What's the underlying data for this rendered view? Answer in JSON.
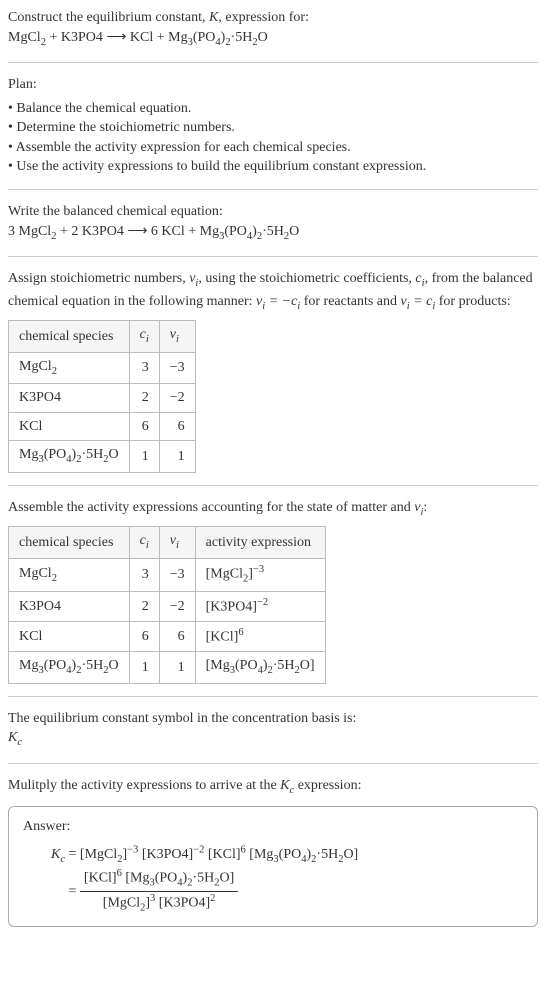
{
  "intro": {
    "line1": "Construct the equilibrium constant, ",
    "K": "K",
    "line1b": ", expression for:",
    "equation_lhs": "MgCl₂ + K3PO4",
    "arrow": " ⟶ ",
    "equation_rhs": "KCl + Mg₃(PO₄)₂·5H₂O"
  },
  "plan": {
    "heading": "Plan:",
    "items": [
      "Balance the chemical equation.",
      "Determine the stoichiometric numbers.",
      "Assemble the activity expression for each chemical species.",
      "Use the activity expressions to build the equilibrium constant expression."
    ]
  },
  "balanced": {
    "heading": "Write the balanced chemical equation:",
    "lhs": "3 MgCl₂ + 2 K3PO4",
    "arrow": " ⟶ ",
    "rhs": "6 KCl + Mg₃(PO₄)₂·5H₂O"
  },
  "stoich": {
    "text1": "Assign stoichiometric numbers, ",
    "nu_i": "νᵢ",
    "text2": ", using the stoichiometric coefficients, ",
    "c_i": "cᵢ",
    "text3": ", from the balanced chemical equation in the following manner: ",
    "rel1": "νᵢ = −cᵢ",
    "text4": " for reactants and ",
    "rel2": "νᵢ = cᵢ",
    "text5": " for products:",
    "headers": {
      "species": "chemical species",
      "c": "cᵢ",
      "nu": "νᵢ"
    },
    "rows": [
      {
        "species": "MgCl₂",
        "c": "3",
        "nu": "−3"
      },
      {
        "species": "K3PO4",
        "c": "2",
        "nu": "−2"
      },
      {
        "species": "KCl",
        "c": "6",
        "nu": "6"
      },
      {
        "species": "Mg₃(PO₄)₂·5H₂O",
        "c": "1",
        "nu": "1"
      }
    ]
  },
  "activity": {
    "text1": "Assemble the activity expressions accounting for the state of matter and ",
    "nu_i": "νᵢ",
    "text2": ":",
    "headers": {
      "species": "chemical species",
      "c": "cᵢ",
      "nu": "νᵢ",
      "expr": "activity expression"
    },
    "rows": [
      {
        "species": "MgCl₂",
        "c": "3",
        "nu": "−3",
        "expr": "[MgCl₂]⁻³"
      },
      {
        "species": "K3PO4",
        "c": "2",
        "nu": "−2",
        "expr": "[K3PO4]⁻²"
      },
      {
        "species": "KCl",
        "c": "6",
        "nu": "6",
        "expr": "[KCl]⁶"
      },
      {
        "species": "Mg₃(PO₄)₂·5H₂O",
        "c": "1",
        "nu": "1",
        "expr": "[Mg₃(PO₄)₂·5H₂O]"
      }
    ]
  },
  "symbol": {
    "line": "The equilibrium constant symbol in the concentration basis is:",
    "Kc": "K_c"
  },
  "multiply": {
    "text1": "Mulitply the activity expressions to arrive at the ",
    "Kc": "K_c",
    "text2": " expression:"
  },
  "answer": {
    "label": "Answer:",
    "Kc": "K_c",
    "eq": " = ",
    "line1": "[MgCl₂]⁻³ [K3PO4]⁻² [KCl]⁶ [Mg₃(PO₄)₂·5H₂O]",
    "frac_num": "[KCl]⁶ [Mg₃(PO₄)₂·5H₂O]",
    "frac_den": "[MgCl₂]³ [K3PO4]²"
  }
}
